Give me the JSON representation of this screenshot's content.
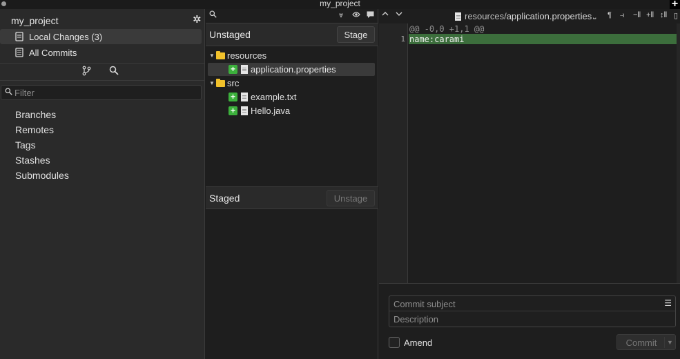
{
  "window": {
    "title": "my_project"
  },
  "sidebar": {
    "project_name": "my_project",
    "nav": [
      {
        "label": "Local Changes (3)",
        "selected": true,
        "icon": "local-changes-icon"
      },
      {
        "label": "All Commits",
        "selected": false,
        "icon": "commits-icon"
      }
    ],
    "filter_placeholder": "Filter",
    "sections": [
      "Branches",
      "Remotes",
      "Tags",
      "Stashes",
      "Submodules"
    ]
  },
  "unstaged": {
    "title": "Unstaged",
    "button": "Stage",
    "tree": [
      {
        "type": "folder",
        "name": "resources"
      },
      {
        "type": "file",
        "name": "application.properties",
        "status": "added",
        "selected": true
      },
      {
        "type": "folder",
        "name": "src"
      },
      {
        "type": "file",
        "name": "example.txt",
        "status": "added"
      },
      {
        "type": "file",
        "name": "Hello.java",
        "status": "added"
      }
    ]
  },
  "staged": {
    "title": "Staged",
    "button": "Unstage"
  },
  "diff": {
    "path_dir": "resources/",
    "path_file": "application.properties",
    "hunk_header": "@@ -0,0 +1,1 @@",
    "lines": [
      {
        "number": "1",
        "text": "name:carami",
        "kind": "added"
      }
    ]
  },
  "commit": {
    "subject_placeholder": "Commit subject",
    "description_placeholder": "Description",
    "amend_label": "Amend",
    "button": "Commit"
  },
  "colors": {
    "added_badge": "#3cb03c",
    "added_line": "#3c6e3c",
    "folder": "#f1c12b"
  }
}
